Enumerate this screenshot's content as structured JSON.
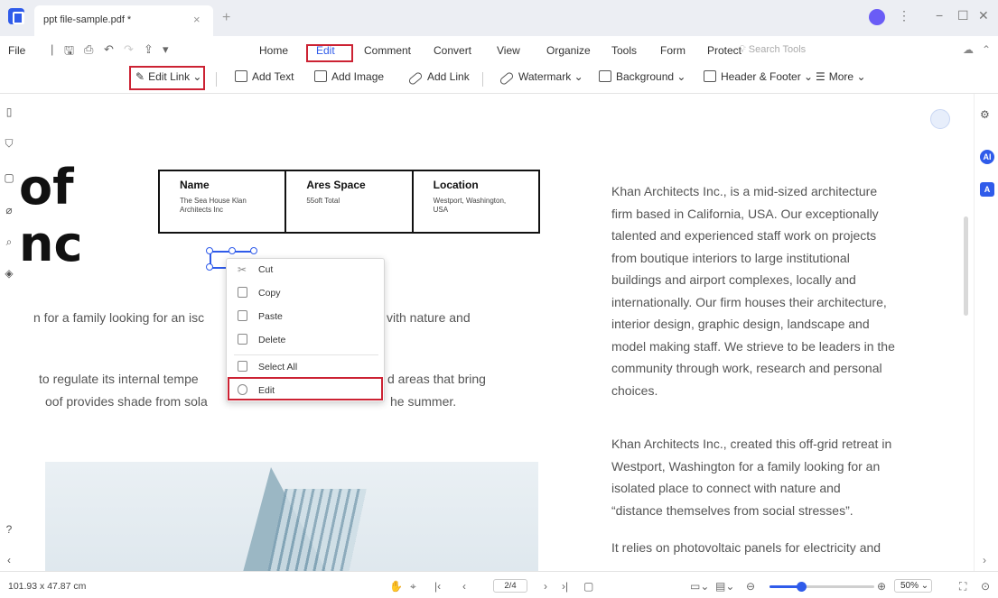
{
  "titlebar": {
    "tab_title": "ppt file-sample.pdf *",
    "tab_close": "×",
    "tab_add": "+",
    "win_more": "⋮",
    "win_min": "−",
    "win_max": "☐",
    "win_close": "✕"
  },
  "menubar": {
    "file": "File",
    "items": [
      "Home",
      "Edit",
      "Comment",
      "Convert",
      "View",
      "Organize",
      "Tools",
      "Form",
      "Protect"
    ],
    "active": "Edit",
    "search_placeholder": "Search Tools"
  },
  "toolbar": {
    "edit_link": "Edit Link",
    "add_text": "Add Text",
    "add_image": "Add Image",
    "add_link": "Add Link",
    "watermark": "Watermark",
    "background": "Background",
    "header_footer": "Header & Footer",
    "more": "More"
  },
  "document": {
    "big_top": "of",
    "big_mid": "nc",
    "table": {
      "headers": [
        "Name",
        "Ares Space",
        "Location"
      ],
      "values": [
        "The Sea House Klan Architects Inc",
        "55oft Total",
        "Westport, Washington, USA"
      ]
    },
    "left_line1_a": "n for a family looking for an isc",
    "left_line1_b": "vith nature and",
    "left_line2_a": "to regulate its internal tempe",
    "left_line2_b": "d areas that bring",
    "left_line3_a": "oof provides shade from sola",
    "left_line3_b": "he summer.",
    "right_para1": [
      "Khan Architects Inc., is a mid-sized architecture",
      "firm based in California, USA. Our exceptionally",
      "talented and experienced staff work on projects",
      "from boutique interiors to large institutional",
      "buildings and airport complexes, locally and",
      "internationally. Our firm houses their architecture,",
      "interior design, graphic design, landscape and",
      "model making staff. We strieve to be leaders in the",
      "community through work, research and personal",
      "choices."
    ],
    "right_para2": [
      "Khan Architects Inc., created this off-grid retreat in",
      "Westport, Washington for a family looking for an",
      "isolated place to connect with nature and",
      "“distance themselves from social stresses”."
    ],
    "right_para3": [
      "It relies on photovoltaic panels for electricity and"
    ]
  },
  "context_menu": {
    "items": [
      "Cut",
      "Copy",
      "Paste",
      "Delete",
      "Select All",
      "Edit"
    ]
  },
  "statusbar": {
    "dimensions": "101.93 x 47.87 cm",
    "page": "2/4",
    "zoom": "50%",
    "zoom_level": 0.3
  },
  "colors": {
    "accent": "#2f5bea",
    "highlight_box": "#cc2233"
  }
}
